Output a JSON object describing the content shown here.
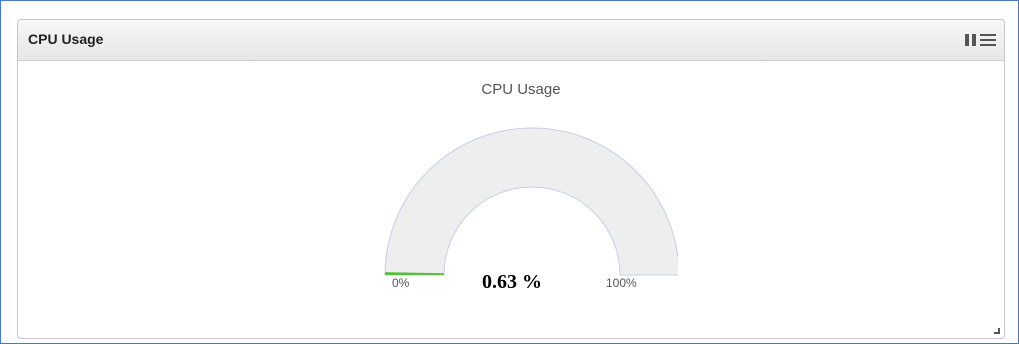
{
  "widget": {
    "title": "CPU Usage",
    "controls": {
      "pause_icon": "pause-icon",
      "menu_icon": "menu-icon"
    }
  },
  "chart_data": {
    "type": "gauge",
    "title": "CPU Usage",
    "value": 0.63,
    "value_label": "0.63 %",
    "min": 0,
    "max": 100,
    "min_label": "0%",
    "max_label": "100%",
    "colors": {
      "track": "#eeeeee",
      "track_border": "#c8cde6",
      "fill": "#55bf3b"
    }
  }
}
